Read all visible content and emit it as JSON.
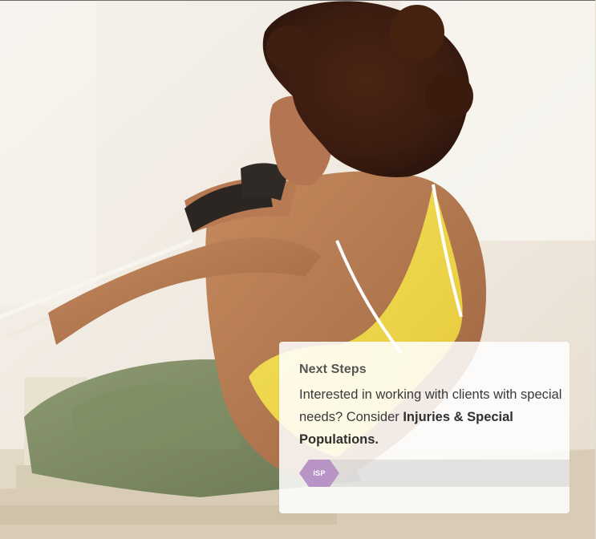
{
  "card": {
    "title": "Next Steps",
    "body_text": "Interested in working with clients with special needs? Consider ",
    "link_text": "Injuries & Special Populations.",
    "badge": {
      "label": "ISP",
      "color": "#b893c6",
      "icon": "hexagon-icon"
    }
  },
  "hero": {
    "description": "pilates-reformer-photo"
  }
}
